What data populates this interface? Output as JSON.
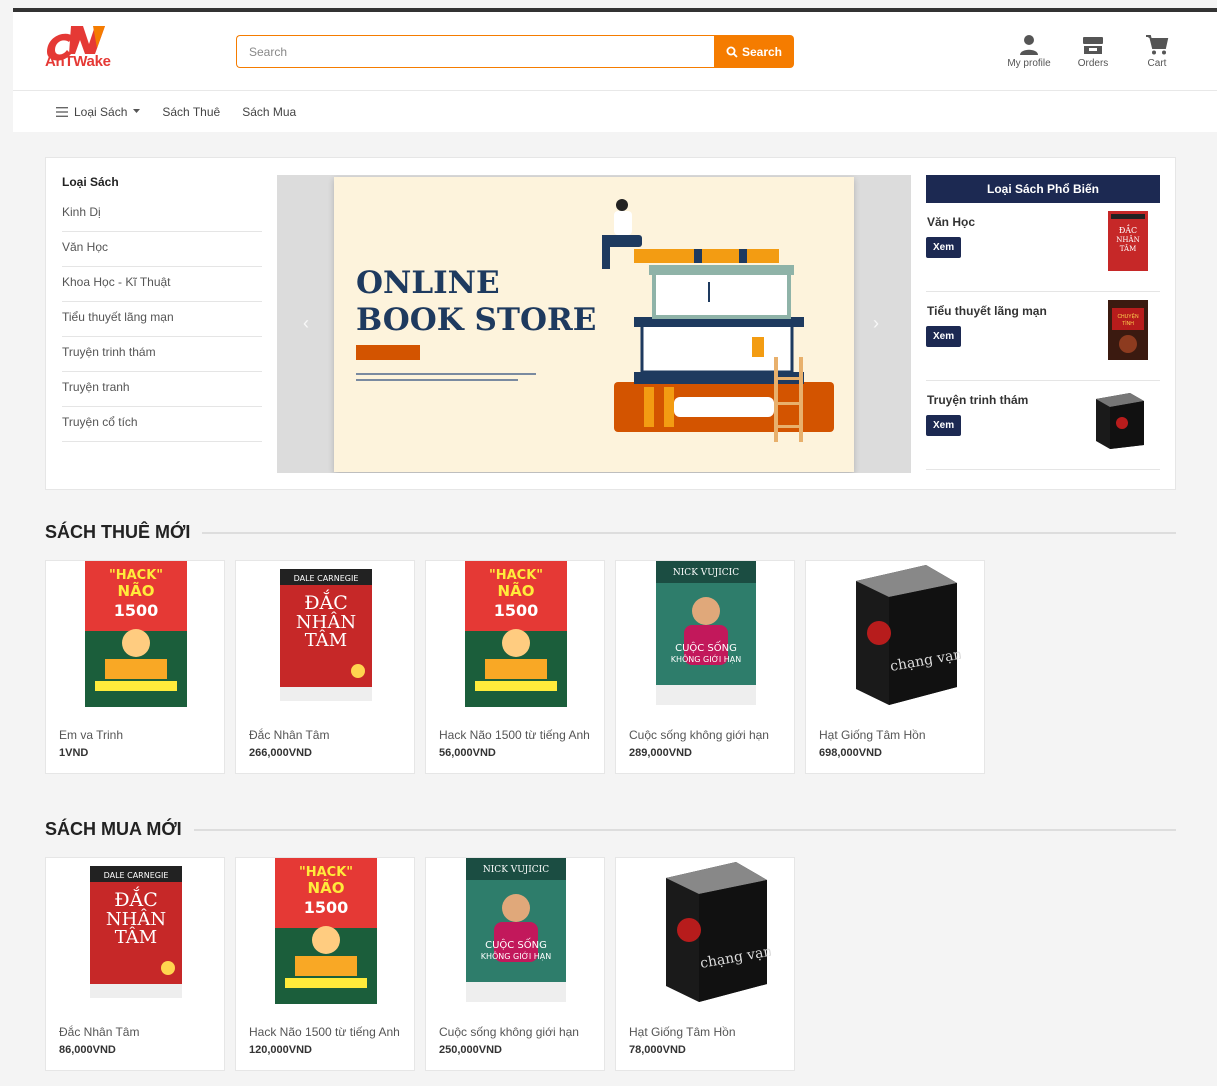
{
  "header": {
    "logo_text": "AnTWake",
    "search_placeholder": "Search",
    "search_button": "Search",
    "icons": [
      {
        "label": "My profile",
        "icon": "user-icon"
      },
      {
        "label": "Orders",
        "icon": "orders-icon"
      },
      {
        "label": "Cart",
        "icon": "cart-icon"
      }
    ]
  },
  "nav": {
    "categories_label": "Loại Sách",
    "rent_label": "Sách Thuê",
    "buy_label": "Sách Mua"
  },
  "sidebar": {
    "title": "Loại Sách",
    "items": [
      "Kinh Dị",
      "Văn Học",
      "Khoa Học - Kĩ Thuật",
      "Tiểu thuyết lãng mạn",
      "Truyện trinh thám",
      "Truyện tranh",
      "Truyện cổ tích"
    ]
  },
  "banner": {
    "title_line1": "ONLINE",
    "title_line2": "BOOK STORE"
  },
  "popular": {
    "title": "Loại Sách Phổ Biến",
    "items": [
      {
        "name": "Văn Học",
        "button": "Xem",
        "cover": "dac-nhan-tam"
      },
      {
        "name": "Tiểu thuyết lãng mạn",
        "button": "Xem",
        "cover": "chuyen-tinh"
      },
      {
        "name": "Truyện trinh thám",
        "button": "Xem",
        "cover": "chang-vang"
      }
    ]
  },
  "rent_section": {
    "title": "SÁCH THUÊ MỚI",
    "books": [
      {
        "name": "Em va Trinh",
        "price": "1VND",
        "cover": "hack-nao"
      },
      {
        "name": "Đắc Nhân Tâm",
        "price": "266,000VND",
        "cover": "dac-nhan-tam"
      },
      {
        "name": "Hack Não 1500 từ tiếng Anh",
        "price": "56,000VND",
        "cover": "hack-nao"
      },
      {
        "name": "Cuộc sống không giới hạn",
        "price": "289,000VND",
        "cover": "cuoc-song"
      },
      {
        "name": "Hạt Giống Tâm Hồn",
        "price": "698,000VND",
        "cover": "chang-vang"
      }
    ]
  },
  "buy_section": {
    "title": "SÁCH MUA MỚI",
    "books": [
      {
        "name": "Đắc Nhân Tâm",
        "price": "86,000VND",
        "cover": "dac-nhan-tam"
      },
      {
        "name": "Hack Não 1500 từ tiếng Anh",
        "price": "120,000VND",
        "cover": "hack-nao"
      },
      {
        "name": "Cuộc sống không giới hạn",
        "price": "250,000VND",
        "cover": "cuoc-song"
      },
      {
        "name": "Hạt Giống Tâm Hồn",
        "price": "78,000VND",
        "cover": "chang-vang"
      }
    ]
  },
  "colors": {
    "accent": "#f57c00",
    "navy": "#1c2952",
    "logo_red": "#e53935"
  }
}
